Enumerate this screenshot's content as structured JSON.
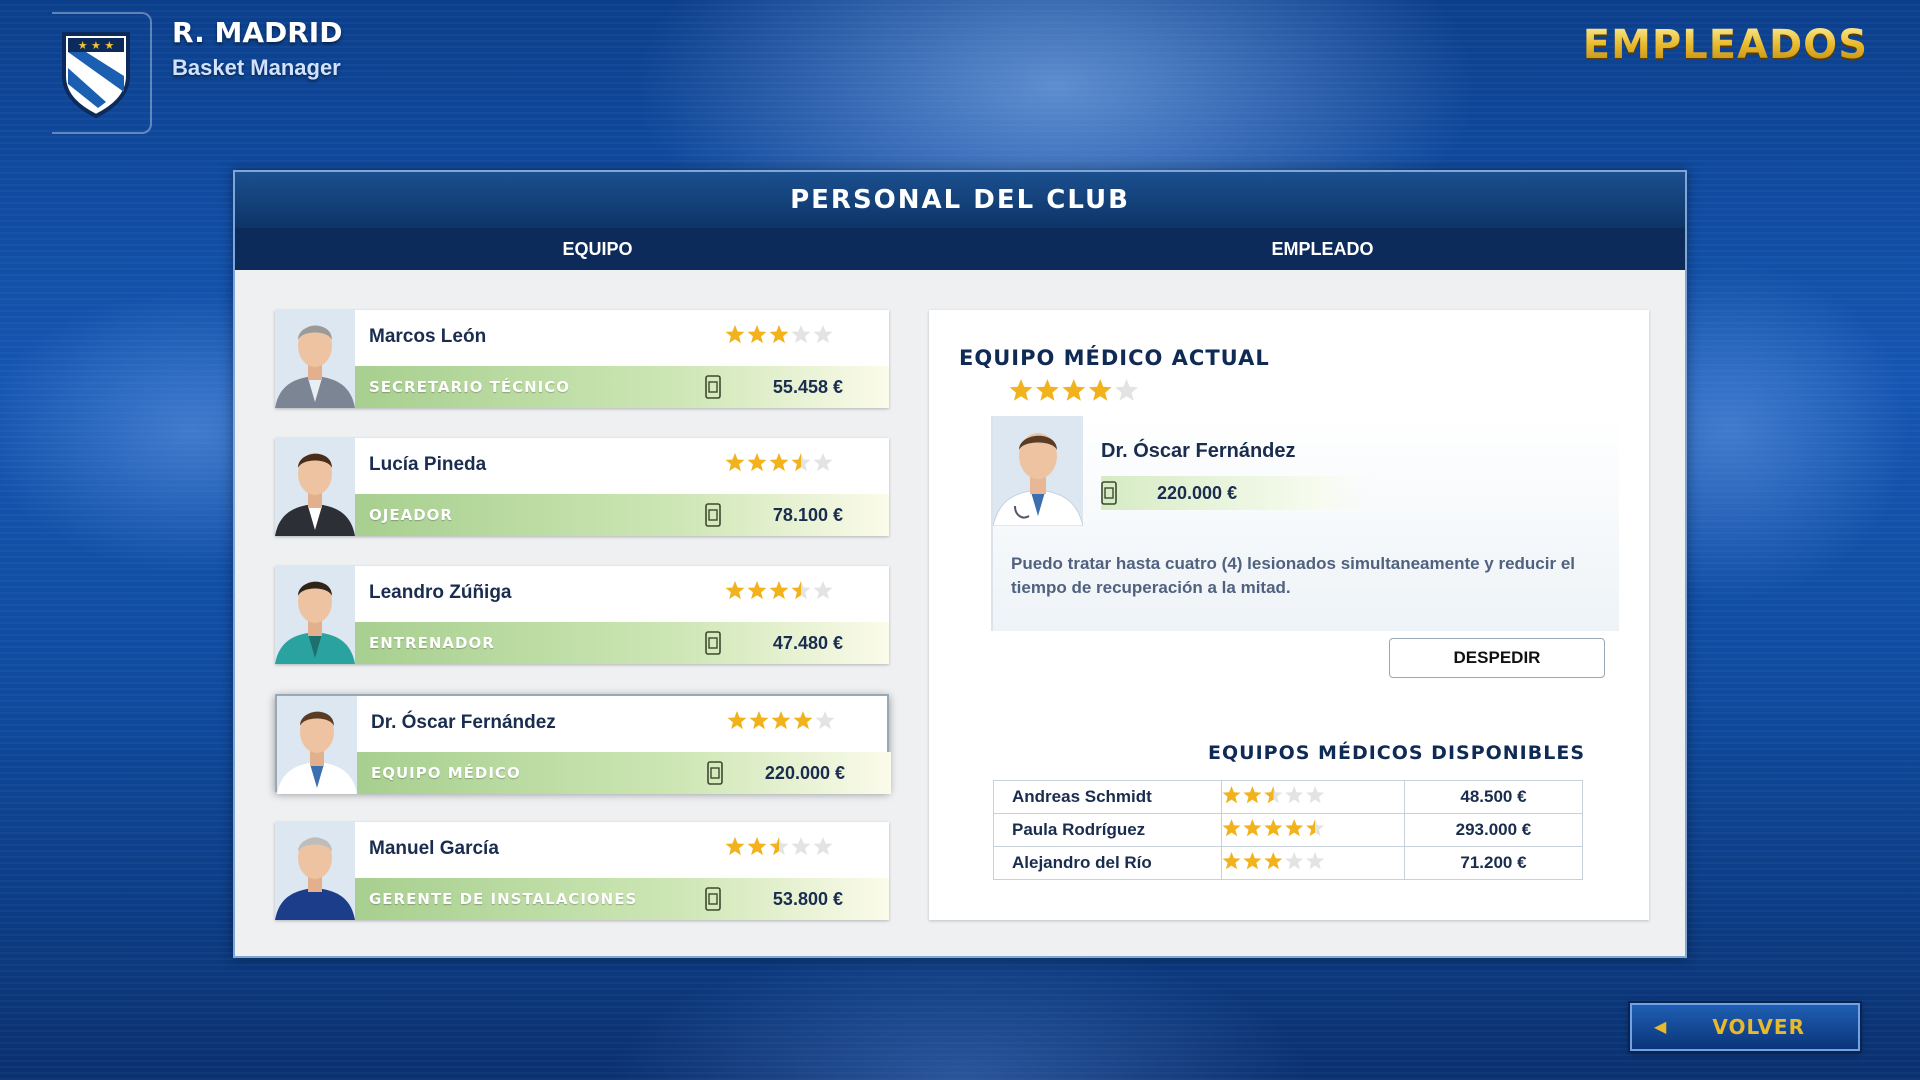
{
  "header": {
    "club_name": "R. MADRID",
    "subtitle": "Basket Manager",
    "screen_title": "EMPLEADOS"
  },
  "panel": {
    "title": "PERSONAL DEL CLUB",
    "tabs": [
      "EQUIPO",
      "EMPLEADO"
    ]
  },
  "staff": [
    {
      "name": "Marcos León",
      "role": "SECRETARIO TÉCNICO",
      "salary": "55.458 €",
      "rating": 3
    },
    {
      "name": "Lucía Pineda",
      "role": "OJEADOR",
      "salary": "78.100 €",
      "rating": 3.5
    },
    {
      "name": "Leandro Zúñiga",
      "role": "ENTRENADOR",
      "salary": "47.480 €",
      "rating": 3.5
    },
    {
      "name": "Dr. Óscar Fernández",
      "role": "EQUIPO MÉDICO",
      "salary": "220.000 €",
      "rating": 4
    },
    {
      "name": "Manuel García",
      "role": "GERENTE DE INSTALACIONES",
      "salary": "53.800 €",
      "rating": 2.5
    }
  ],
  "selected_index": 3,
  "detail": {
    "title": "EQUIPO MÉDICO ACTUAL",
    "rating": 4,
    "name": "Dr. Óscar Fernández",
    "salary": "220.000 €",
    "description": "Puedo tratar hasta cuatro (4) lesionados simultaneamente y reducir el tiempo de recuperación a la mitad.",
    "fire_label": "DESPEDIR",
    "available_title": "EQUIPOS MÉDICOS DISPONIBLES",
    "available": [
      {
        "name": "Andreas Schmidt",
        "rating": 2.5,
        "salary": "48.500 €"
      },
      {
        "name": "Paula Rodríguez",
        "rating": 4.5,
        "salary": "293.000 €"
      },
      {
        "name": "Alejandro del Río",
        "rating": 3,
        "salary": "71.200 €"
      }
    ]
  },
  "back_label": "VOLVER",
  "colors": {
    "star_on": "#f2b21c",
    "star_off": "#e3e3e3",
    "gold": "#e7b92c",
    "navy": "#0c2a5a"
  }
}
